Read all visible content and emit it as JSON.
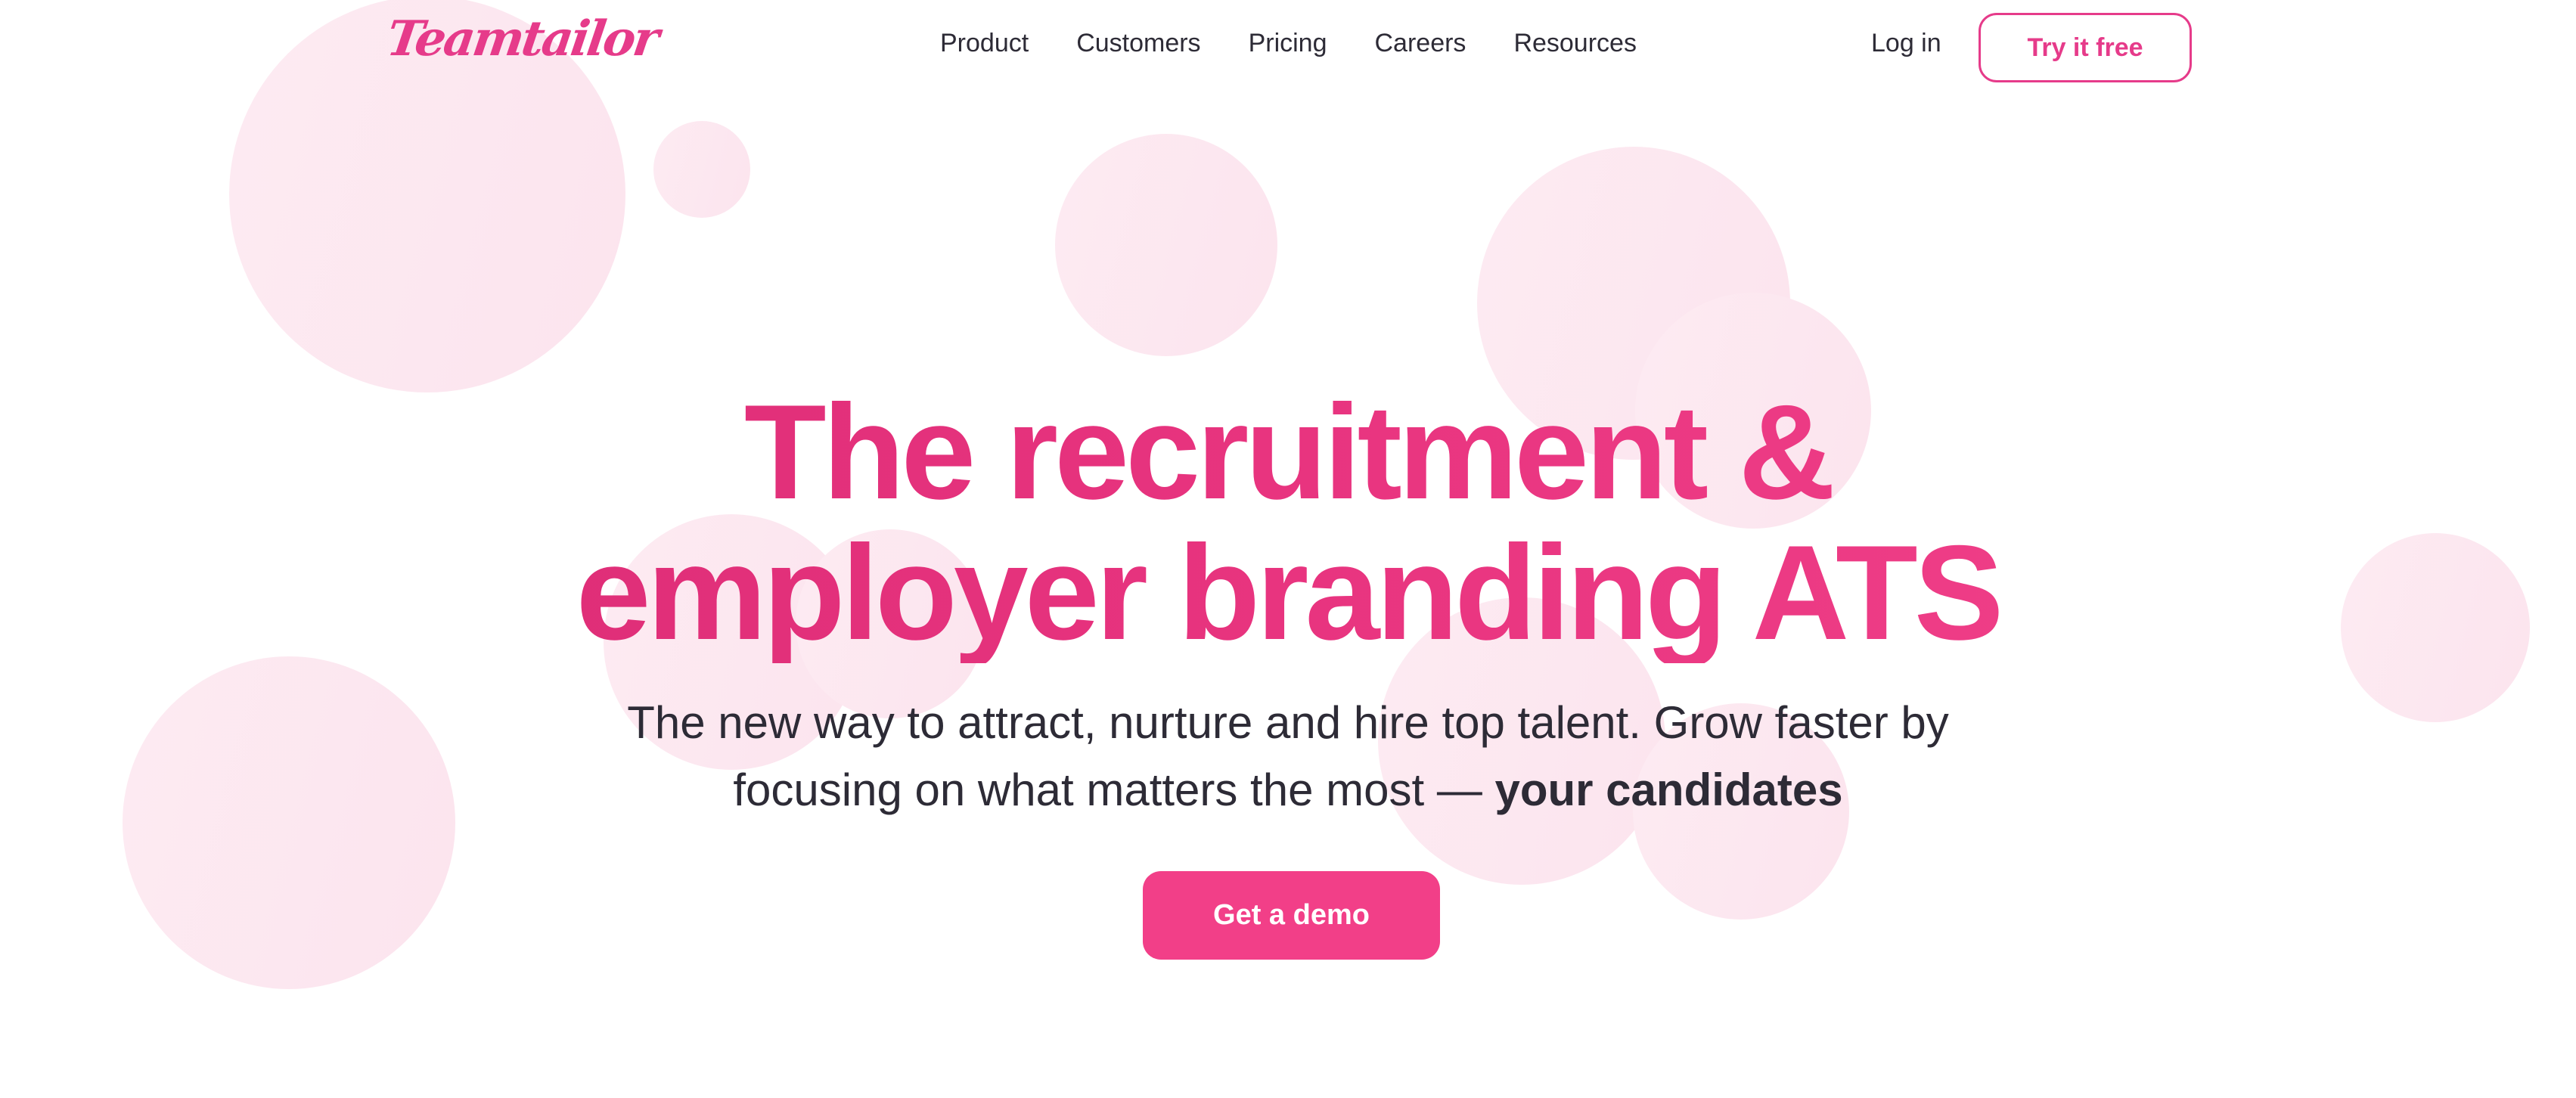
{
  "brand": {
    "logo_text": "Teamtailor",
    "accent_color": "#e63b8a",
    "button_color": "#f23f88"
  },
  "nav": {
    "links": [
      "Product",
      "Customers",
      "Pricing",
      "Careers",
      "Resources"
    ],
    "login_label": "Log in",
    "try_label": "Try it free"
  },
  "hero": {
    "headline_line1": "The recruitment &",
    "headline_line2": "employer branding ATS",
    "subtitle_main": "The new way to attract, nurture and hire top talent. Grow faster by focusing on what matters the most — ",
    "subtitle_emphasis": "your candidates",
    "cta_label": "Get a demo"
  }
}
